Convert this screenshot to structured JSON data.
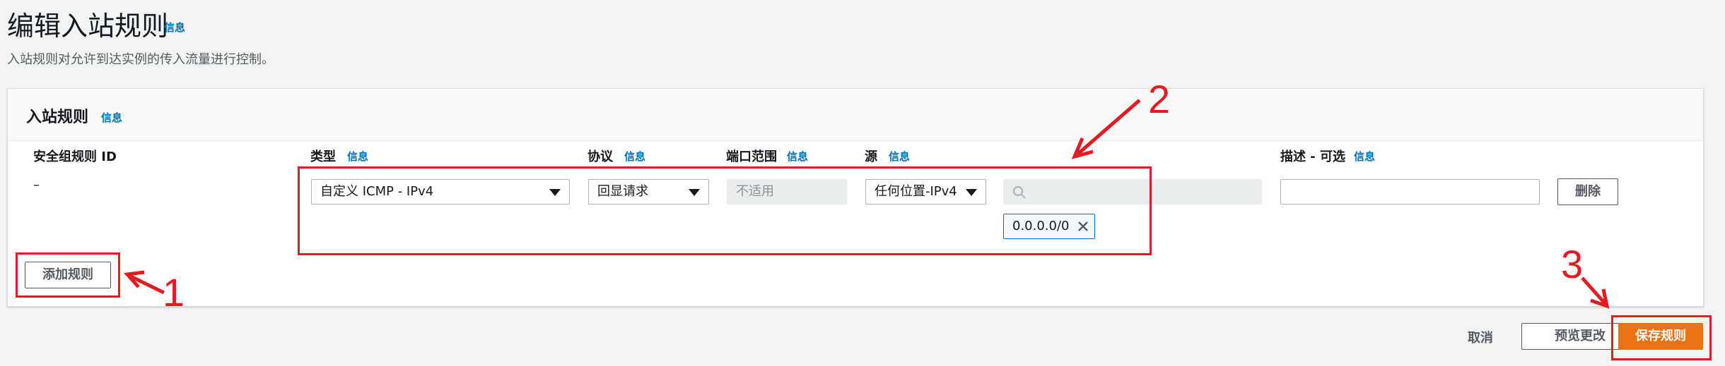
{
  "page": {
    "title": "编辑入站规则",
    "title_info": "信息",
    "description": "入站规则对允许到达实例的传入流量进行控制。"
  },
  "panel": {
    "title": "入站规则",
    "info": "信息"
  },
  "columns": {
    "rule_id": "安全组规则 ID",
    "type": "类型",
    "type_info": "信息",
    "protocol": "协议",
    "protocol_info": "信息",
    "port_range": "端口范围",
    "port_range_info": "信息",
    "source": "源",
    "source_info": "信息",
    "description": "描述 - 可选",
    "description_info": "信息"
  },
  "rule": {
    "rule_id": "–",
    "type_value": "自定义 ICMP - IPv4",
    "protocol_value": "回显请求",
    "port_range_placeholder": "不适用",
    "source_value": "任何位置-IPv4",
    "cidr_token": "0.0.0.0/0",
    "search_value": "",
    "description_value": "",
    "delete_label": "删除"
  },
  "add_rule_label": "添加规则",
  "footer": {
    "cancel_label": "取消",
    "preview_label": "预览更改",
    "save_label": "保存规则"
  },
  "annotations": {
    "one": "1",
    "two": "2",
    "three": "3"
  },
  "icons": {
    "search": "search-icon",
    "caret": "caret-down-icon",
    "remove": "close-icon"
  },
  "colors": {
    "info_link": "#0073bb",
    "primary": "#ec7211",
    "annotation": "#e31b23",
    "page_bg": "#f2f3f3"
  }
}
